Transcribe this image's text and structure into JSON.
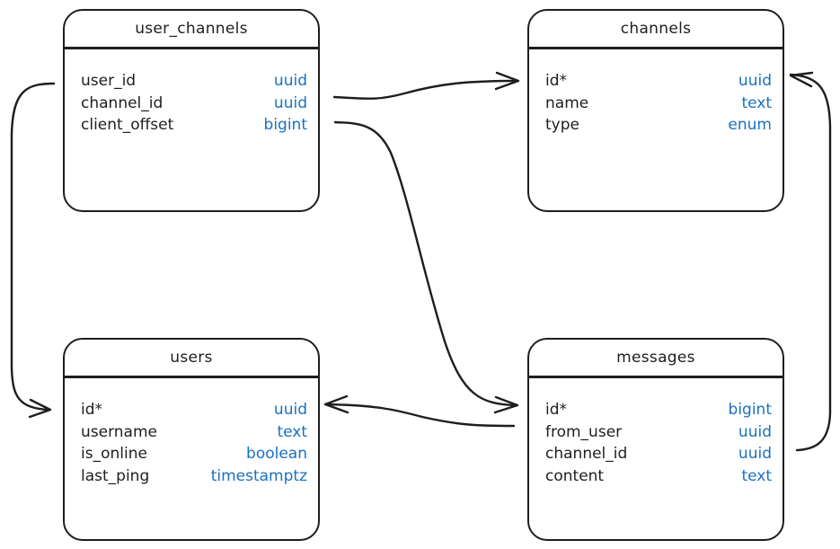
{
  "diagram": {
    "type": "entity-relationship",
    "tables": [
      {
        "id": "user_channels",
        "title": "user_channels",
        "fields": [
          {
            "name": "user_id",
            "type": "uuid"
          },
          {
            "name": "channel_id",
            "type": "uuid"
          },
          {
            "name": "client_offset",
            "type": "bigint"
          }
        ]
      },
      {
        "id": "channels",
        "title": "channels",
        "fields": [
          {
            "name": "id*",
            "type": "uuid"
          },
          {
            "name": "name",
            "type": "text"
          },
          {
            "name": "type",
            "type": "enum"
          }
        ]
      },
      {
        "id": "users",
        "title": "users",
        "fields": [
          {
            "name": "id*",
            "type": "uuid"
          },
          {
            "name": "username",
            "type": "text"
          },
          {
            "name": "is_online",
            "type": "boolean"
          },
          {
            "name": "last_ping",
            "type": "timestamptz"
          }
        ]
      },
      {
        "id": "messages",
        "title": "messages",
        "fields": [
          {
            "name": "id*",
            "type": "bigint"
          },
          {
            "name": "from_user",
            "type": "uuid"
          },
          {
            "name": "channel_id",
            "type": "uuid"
          },
          {
            "name": "content",
            "type": "text"
          }
        ]
      }
    ],
    "relationships": [
      {
        "from": "user_channels.user_id",
        "to": "users.id*"
      },
      {
        "from": "user_channels.channel_id",
        "to": "channels.id*"
      },
      {
        "from": "user_channels.client_offset",
        "to": "messages.id*"
      },
      {
        "from": "messages.from_user",
        "to": "users.id*"
      },
      {
        "from": "messages.channel_id",
        "to": "channels.id*"
      }
    ],
    "colors": {
      "stroke": "#1e1e1e",
      "type_text": "#1971c2",
      "background": "#ffffff"
    }
  }
}
